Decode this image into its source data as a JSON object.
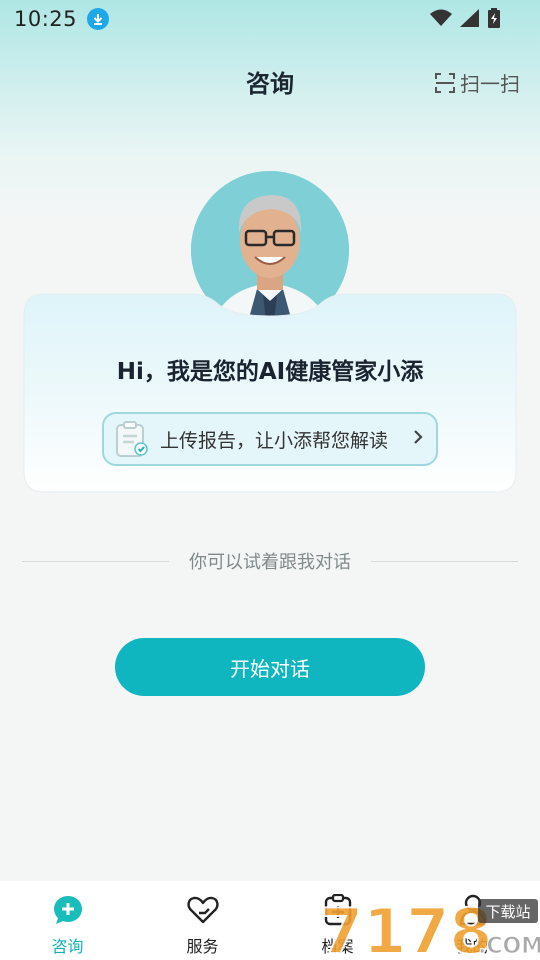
{
  "status_bar": {
    "time": "10:25",
    "icons": [
      "download-icon",
      "wifi-icon",
      "signal-icon",
      "battery-icon"
    ]
  },
  "header": {
    "title": "咨询",
    "scan_label": "扫一扫"
  },
  "card": {
    "greeting": "Hi，我是您的AI健康管家小添",
    "upload_label": "上传报告，让小添帮您解读"
  },
  "hint": "你可以试着跟我对话",
  "start_button": "开始对话",
  "nav": {
    "items": [
      {
        "label": "咨询",
        "icon": "chat-plus-icon",
        "active": true
      },
      {
        "label": "服务",
        "icon": "heart-hand-icon",
        "active": false
      },
      {
        "label": "档案",
        "icon": "clipboard-plus-icon",
        "active": false
      },
      {
        "label": "我的",
        "icon": "user-icon",
        "active": false
      }
    ]
  },
  "watermark": {
    "text": "7178",
    "sub": "下载站",
    "domain": ".COM"
  },
  "colors": {
    "accent": "#0fb6bf",
    "active_nav": "#12b1b6",
    "upload_border": "#9fd7df"
  }
}
